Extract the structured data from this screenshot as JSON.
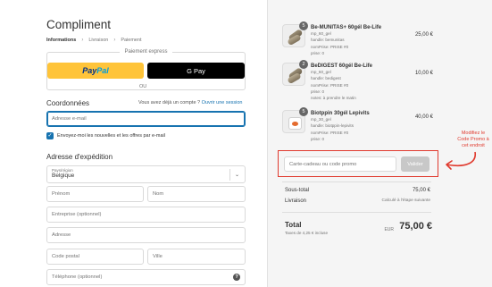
{
  "store": {
    "name": "Compliment"
  },
  "breadcrumb": [
    "Informations",
    "Livraison",
    "Paiement"
  ],
  "express": {
    "title": "Paiement express",
    "paypal_a": "Pay",
    "paypal_b": "Pal",
    "gpay_label": "G Pay",
    "or": "OU"
  },
  "contact": {
    "title": "Coordonnées",
    "login_prompt": "Vous avez déjà un compte ?",
    "login_link": "Ouvrir une session",
    "email_placeholder": "Adresse e-mail",
    "newsletter_label": "Envoyez-moi les nouvelles et les offres par e-mail",
    "newsletter_checked": true
  },
  "shipping": {
    "title": "Adresse d'expédition",
    "country_label": "Pays/région",
    "country_value": "Belgique",
    "first_name": "Prénom",
    "last_name": "Nom",
    "company": "Entreprise (optionnel)",
    "address": "Adresse",
    "postal_code": "Code postal",
    "city": "Ville",
    "phone": "Téléphone (optionnel)"
  },
  "cart": {
    "items": [
      {
        "qty": "5",
        "name": "Be-MUNITAS+ 60gél Be-Life",
        "meta": [
          "mp_60_gel",
          "handle: bemunitas",
          "nomPrise: PRISE #0",
          "prise: 0"
        ],
        "price": "25,00 €"
      },
      {
        "qty": "2",
        "name": "BeDIGEST 60gél Be-Life",
        "meta": [
          "mp_60_gel",
          "handle: bedigest",
          "nomPrise: PRISE #0",
          "prise: 0",
          "notes: à prendre le matin"
        ],
        "price": "10,00 €"
      },
      {
        "qty": "5",
        "name": "Biotppin 30gél Lepivits",
        "meta": [
          "mp_30_gel",
          "handle: biotppin-lepivits",
          "nomPrise: PRISE #0",
          "prise: 0"
        ],
        "price": "40,00 €"
      }
    ],
    "discount_placeholder": "Carte-cadeau ou code promo",
    "apply_label": "Valider",
    "subtotal_label": "Sous-total",
    "subtotal_value": "75,00 €",
    "shipping_label": "Livraison",
    "shipping_value": "Calculé à l'étape suivante",
    "total_label": "Total",
    "tax_note": "Taxes de 4,25 € incluse",
    "currency": "EUR",
    "total_value": "75,00 €"
  },
  "annotation": {
    "text": "Modifiez le Code Promo à cet endroit"
  },
  "colors": {
    "accent": "#1773b0",
    "annotation": "#e03a2e",
    "paypal": "#ffc439"
  },
  "icons": {
    "help": "help-circle-icon",
    "chevron": "chevron-down-icon",
    "check": "check-icon"
  }
}
